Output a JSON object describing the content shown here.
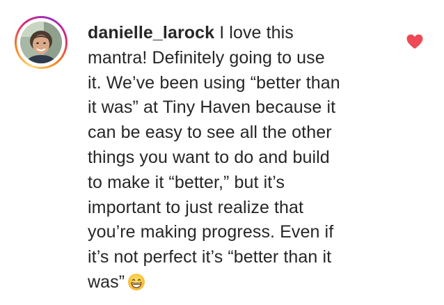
{
  "comment": {
    "username": "danielle_larock",
    "lines": [
      " I love this",
      "mantra! Definitely going to use",
      "it. We’ve been using “better than",
      "it was” at Tiny Haven because it",
      "can be easy to see all the other",
      "things you want to do and build",
      "to make it “better,” but it’s",
      "important to just realize that",
      "you’re making progress. Even if",
      "it’s not perfect it’s “better than it",
      "was”"
    ],
    "emoji": "grinning-face-with-smiling-eyes",
    "liked": true
  },
  "colors": {
    "text": "#262626",
    "like_heart": "#ed4956",
    "story_ring": [
      "#feda75",
      "#fa7e1e",
      "#d62976",
      "#962fbf"
    ]
  }
}
